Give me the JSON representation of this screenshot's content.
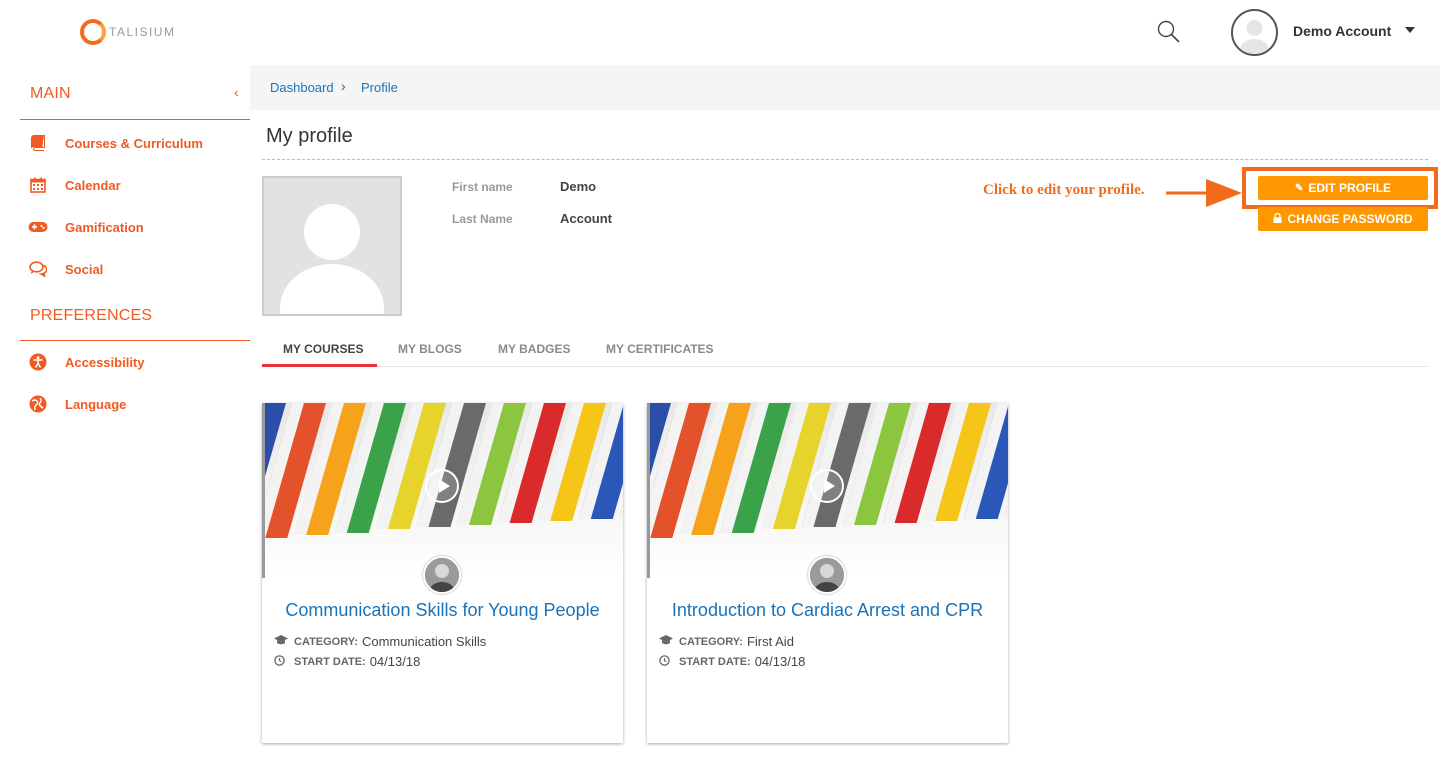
{
  "brand": {
    "logo_text": "TALISIUM"
  },
  "header": {
    "user_name": "Demo Account",
    "search_icon": "search-icon",
    "caret_icon": "caret-down-icon"
  },
  "sidebar": {
    "sections": [
      {
        "title": "MAIN",
        "items": [
          {
            "label": "Courses & Curriculum",
            "icon": "book-icon"
          },
          {
            "label": "Calendar",
            "icon": "calendar-icon"
          },
          {
            "label": "Gamification",
            "icon": "gamepad-icon"
          },
          {
            "label": "Social",
            "icon": "chat-bubbles-icon"
          }
        ]
      },
      {
        "title": "PREFERENCES",
        "items": [
          {
            "label": "Accessibility",
            "icon": "accessibility-icon"
          },
          {
            "label": "Language",
            "icon": "globe-icon"
          }
        ]
      }
    ],
    "collapse_glyph": "‹"
  },
  "breadcrumb": {
    "items": [
      "Dashboard",
      "Profile"
    ],
    "separator": "›"
  },
  "profile": {
    "page_title": "My profile",
    "fields": [
      {
        "label": "First name",
        "value": "Demo"
      },
      {
        "label": "Last Name",
        "value": "Account"
      }
    ],
    "hint": "Click to edit your profile.",
    "edit_button": "EDIT PROFILE",
    "password_button": "CHANGE PASSWORD"
  },
  "tabs": {
    "items": [
      "MY COURSES",
      "MY BLOGS",
      "MY BADGES",
      "MY CERTIFICATES"
    ],
    "active_index": 0
  },
  "courses": [
    {
      "title": "Communication Skills for Young People",
      "category_label": "CATEGORY:",
      "category": "Communication Skills",
      "start_label": "START DATE:",
      "start_date": "04/13/18"
    },
    {
      "title": "Introduction to Cardiac Arrest and CPR",
      "category_label": "CATEGORY:",
      "category": "First Aid",
      "start_label": "START DATE:",
      "start_date": "04/13/18"
    }
  ],
  "colors": {
    "accent": "#f15a22",
    "button": "#ff9800",
    "link": "#1a73b8",
    "tab_underline": "#e8323c"
  }
}
